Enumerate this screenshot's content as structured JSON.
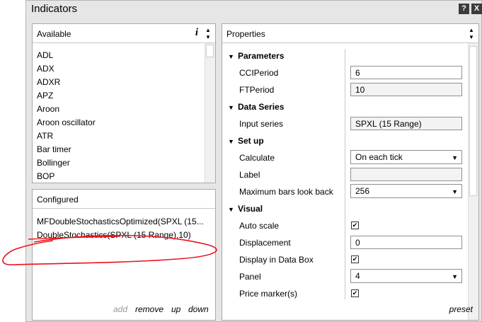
{
  "window": {
    "title": "Indicators",
    "help_label": "?",
    "close_label": "X"
  },
  "available": {
    "header": "Available",
    "info_label": "i",
    "items": [
      "ADL",
      "ADX",
      "ADXR",
      "APZ",
      "Aroon",
      "Aroon oscillator",
      "ATR",
      "Bar timer",
      "Bollinger",
      "BOP"
    ]
  },
  "configured": {
    "header": "Configured",
    "items": [
      "MFDoubleStochasticsOptimized(SPXL (15...",
      "DoubleStochastics(SPXL (15 Range),10)"
    ],
    "actions": {
      "add": "add",
      "remove": "remove",
      "up": "up",
      "down": "down"
    }
  },
  "properties": {
    "header": "Properties",
    "preset_label": "preset",
    "sections": {
      "parameters": "Parameters",
      "data_series": "Data Series",
      "setup": "Set up",
      "visual": "Visual"
    },
    "fields": {
      "cci_label": "CCIPeriod",
      "cci_value": "6",
      "ft_label": "FTPeriod",
      "ft_value": "10",
      "input_label": "Input series",
      "input_value": "SPXL (15 Range)",
      "calc_label": "Calculate",
      "calc_value": "On each tick",
      "label_label": "Label",
      "label_value": "",
      "maxbars_label": "Maximum bars look back",
      "maxbars_value": "256",
      "autoscale_label": "Auto scale",
      "autoscale_checked": true,
      "displacement_label": "Displacement",
      "displacement_value": "0",
      "databox_label": "Display in Data Box",
      "databox_checked": true,
      "panel_label": "Panel",
      "panel_value": "4",
      "pricemarker_label": "Price marker(s)",
      "pricemarker_checked": true
    }
  },
  "colors": {
    "annotation": "#e8121a",
    "background": "#e6e6e6"
  }
}
